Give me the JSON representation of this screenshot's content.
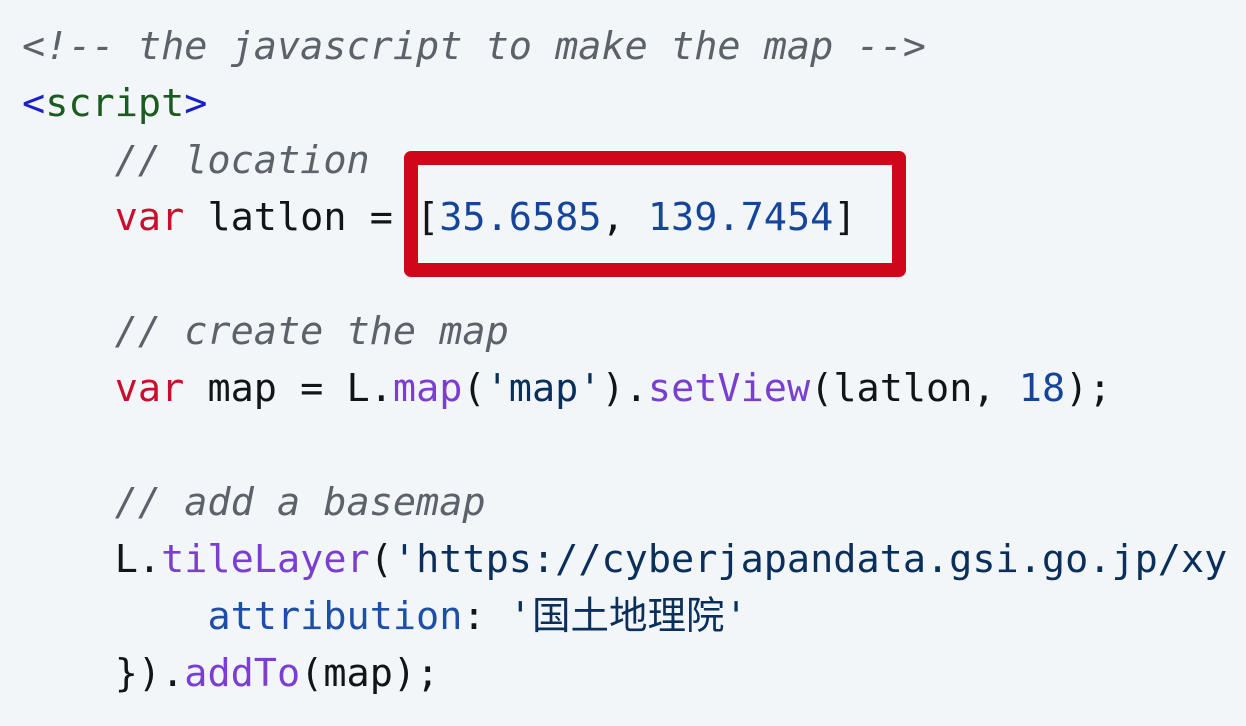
{
  "code": {
    "line1_comment": "<!-- the javascript to make the map -->",
    "line2_open_bracket": "<",
    "line2_tag": "script",
    "line2_close_bracket": ">",
    "line3_comment": "// location",
    "line4_kw": "var",
    "line4_name": " latlon = ",
    "line4_open": "[",
    "line4_lat": "35.6585",
    "line4_comma": ", ",
    "line4_lon": "139.7454",
    "line4_close": "]",
    "line6_comment": "// create the map",
    "line7_kw": "var",
    "line7_a": " map = L.",
    "line7_fn1": "map",
    "line7_b": "(",
    "line7_str": "'map'",
    "line7_c": ").",
    "line7_fn2": "setView",
    "line7_d": "(latlon, ",
    "line7_num": "18",
    "line7_e": ");",
    "line9_comment": "// add a basemap",
    "line10_a": "L.",
    "line10_fn": "tileLayer",
    "line10_b": "(",
    "line10_str": "'https://cyberjapandata.gsi.go.jp/xy",
    "line11_prop": "attribution",
    "line11_colon": ": ",
    "line11_str": "'国土地理院'",
    "line12_a": "}).",
    "line12_fn": "addTo",
    "line12_b": "(map);"
  },
  "colors": {
    "background": "#f3f6f9",
    "highlight_border": "#d0071a",
    "keyword": "#c8102e",
    "number": "#14459b",
    "function": "#7a3fd1",
    "comment": "#5c6269"
  }
}
